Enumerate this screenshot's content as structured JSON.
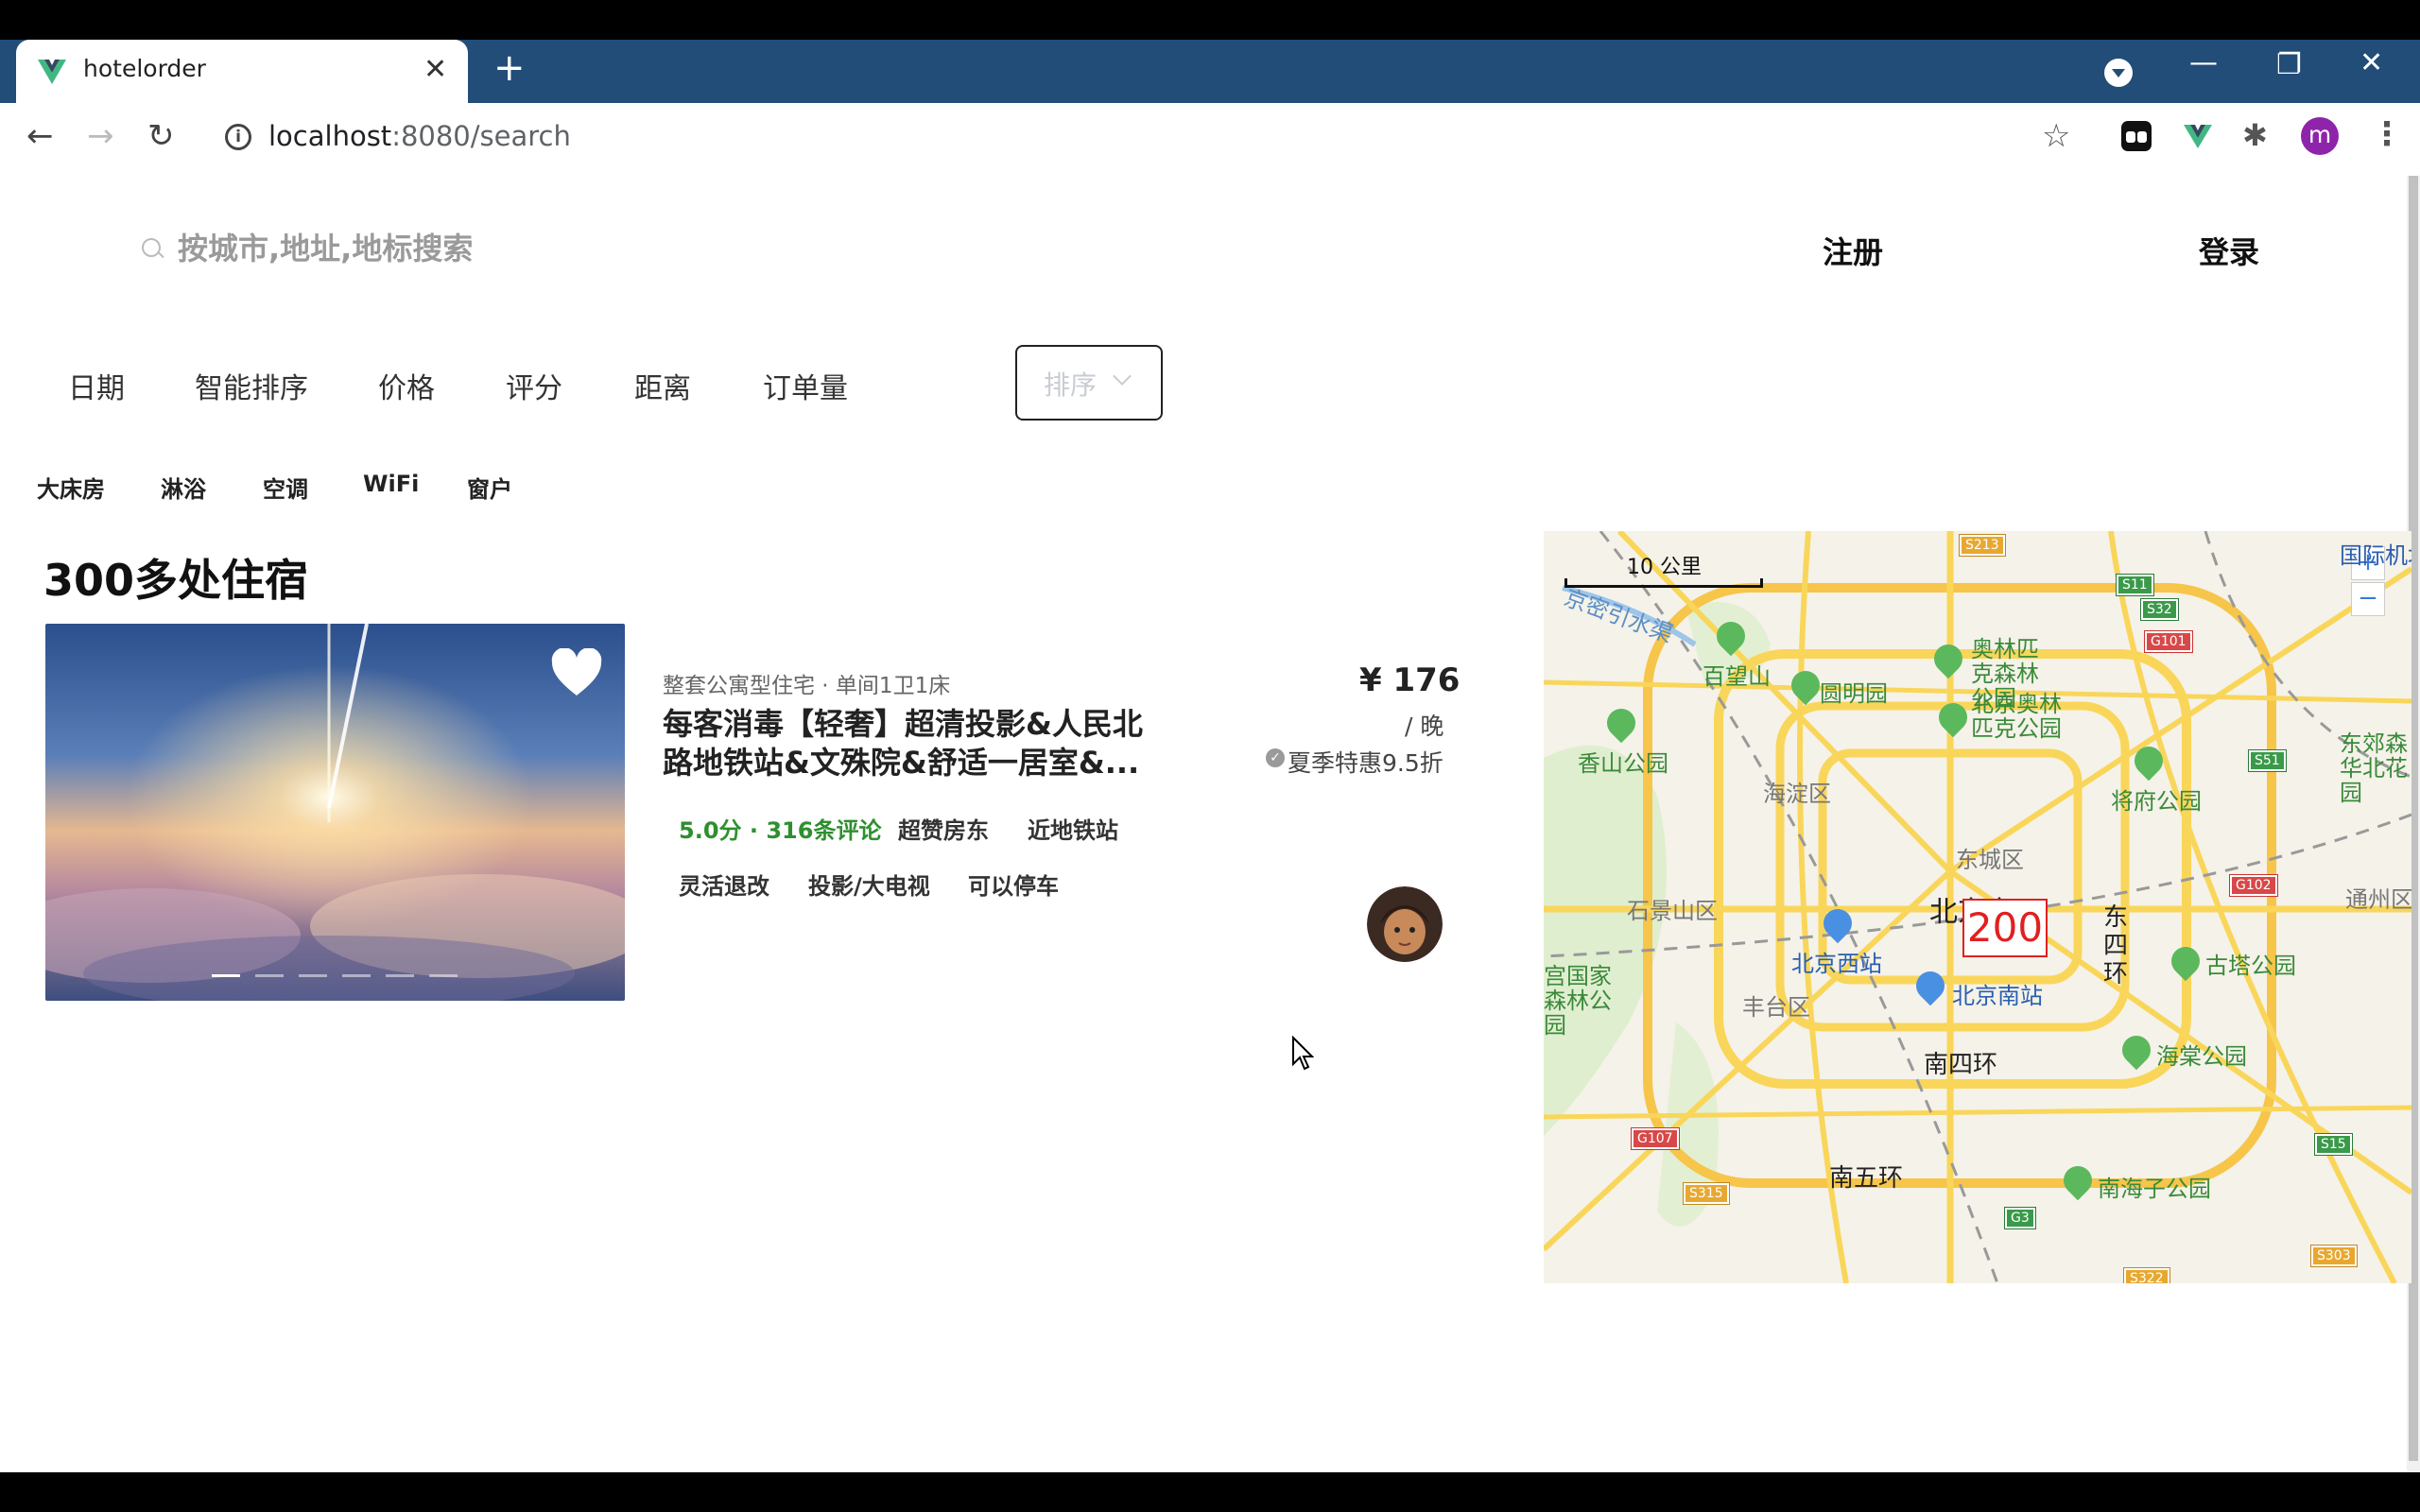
{
  "browser": {
    "tab_title": "hotelorder",
    "url_host": "localhost",
    "url_path": ":8080/search",
    "profile_initial": "m"
  },
  "header": {
    "search_placeholder": "按城市,地址,地标搜索",
    "register": "注册",
    "login": "登录"
  },
  "filters": {
    "tabs": [
      "日期",
      "智能排序",
      "价格",
      "评分",
      "距离",
      "订单量"
    ],
    "sort_placeholder": "排序",
    "amenities": [
      "大床房",
      "淋浴",
      "空调",
      "WiFi",
      "窗户"
    ]
  },
  "results": {
    "count_label": "300多处住宿"
  },
  "listing": {
    "type": "整套公寓型住宅 · 单间1卫1床",
    "title": "每客消毒【轻奢】超清投影&人民北路地铁站&文殊院&舒适一居室&...",
    "rating": "5.0分 · 316条评论",
    "tags_row1": [
      "超赞房东",
      "近地铁站"
    ],
    "tags_row2": [
      "灵活退改",
      "投影/大电视",
      "可以停车"
    ],
    "price": "¥ 176",
    "per_night": "/ 晚",
    "discount": "夏季特惠9.5折",
    "photo_count": 6,
    "active_photo_index": 0
  },
  "map": {
    "scale": "10 公里",
    "zoom_in": "+",
    "zoom_out": "−",
    "cluster_count": "200",
    "labels": {
      "yuanmingyuan": "圆明园",
      "baiwangshan": "百望山",
      "aoti_forest": "奥林匹克森林公园",
      "aoti_park": "北京奥林匹克公园",
      "xiangshan": "香山公园",
      "haidian": "海淀区",
      "dongcheng": "东城区",
      "shijingshan": "石景山区",
      "beijing": "北京市",
      "beijing_west": "北京西站",
      "beijing_south": "北京南站",
      "fengtai": "丰台区",
      "jiangfu": "将府公园",
      "dongsihuan": "东四环",
      "guta": "古塔公园",
      "haitang": "海棠公园",
      "nansihuan": "南四环",
      "nanwuhuan": "南五环",
      "nanhaizi": "南海子公园",
      "tongzhou": "通州区",
      "guojia_forest": "宫国家森林公园",
      "dongjiao": "东郊森华北花园",
      "airport": "国际机场",
      "qushui": "京密引水渠"
    },
    "road_badges": [
      "S213",
      "S11",
      "S32",
      "G101",
      "S51",
      "G102",
      "G107",
      "S315",
      "G3",
      "S15",
      "S303",
      "S322"
    ]
  },
  "colors": {
    "chrome": "#224d78",
    "rating_green": "#2f8f2f",
    "cluster_red": "#e02020"
  }
}
